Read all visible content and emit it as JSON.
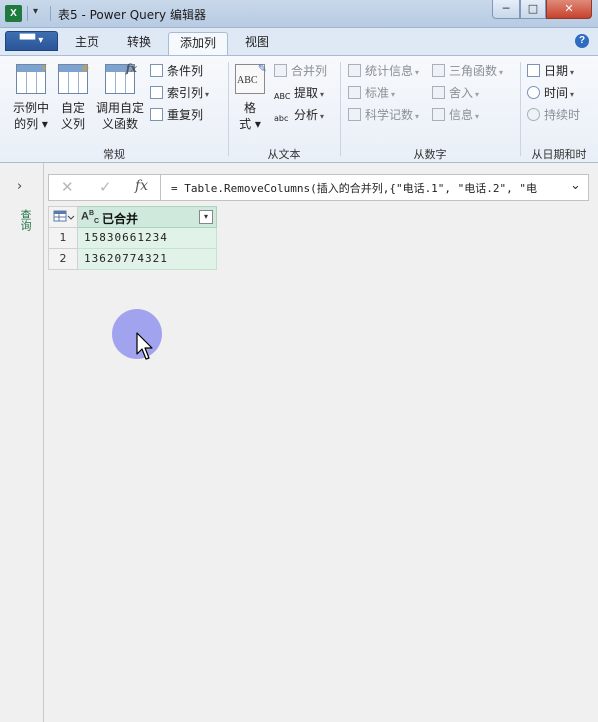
{
  "window": {
    "title": "表5 - Power Query 编辑器",
    "app_icon": "excel-icon",
    "min_glyph": "─",
    "max_glyph": "□",
    "close_glyph": "✕"
  },
  "tabs": {
    "file_label": "▀▀ ▾",
    "items": [
      {
        "label": "主页"
      },
      {
        "label": "转换"
      },
      {
        "label": "添加列"
      },
      {
        "label": "视图"
      }
    ],
    "active": "添加列"
  },
  "ribbon": {
    "general": {
      "label": "常规",
      "example_col": {
        "line1": "示例中",
        "line2": "的列 ▾"
      },
      "custom_col": {
        "line1": "自定",
        "line2": "义列"
      },
      "invoke_func": {
        "line1": "调用自定",
        "line2": "义函数"
      },
      "conditional_col": "条件列",
      "index_col": "索引列",
      "duplicate_col": "重复列"
    },
    "from_text": {
      "label": "从文本",
      "format": {
        "line1": "格",
        "line2": "式 ▾"
      },
      "merge_cols": "合并列",
      "extract": "提取",
      "parse": "分析"
    },
    "from_number": {
      "label": "从数字",
      "statistics": "统计信息",
      "standard": "标准",
      "scientific": "科学记数",
      "trig": "三角函数",
      "rounding": "舍入",
      "info": "信息"
    },
    "from_datetime": {
      "label": "从日期和时",
      "date": "日期",
      "time": "时间",
      "duration": "持续时"
    }
  },
  "nav": {
    "label": "查询"
  },
  "formula_bar": {
    "cancel_glyph": "✕",
    "confirm_glyph": "✓",
    "fx_label": "fx",
    "formula": "= Table.RemoveColumns(插入的合并列,{\"电话.1\", \"电话.2\", \"电"
  },
  "table": {
    "columns": [
      {
        "type_icon": "ABC",
        "name": "已合并"
      }
    ],
    "rows": [
      {
        "num": "1",
        "value": "15830661234"
      },
      {
        "num": "2",
        "value": "13620774321"
      }
    ]
  }
}
